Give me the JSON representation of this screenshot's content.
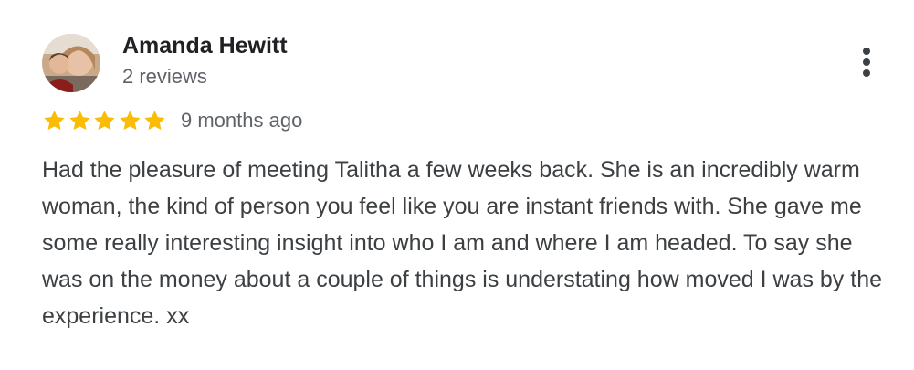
{
  "review": {
    "reviewer_name": "Amanda Hewitt",
    "review_count": "2 reviews",
    "rating": 5,
    "rating_max": 5,
    "star_color": "#fbbc04",
    "timestamp": "9 months ago",
    "text": "Had the pleasure of meeting Talitha a few weeks back. She is an incredibly warm woman, the kind of person you feel like you are instant friends with. She gave me some really interesting insight into who I am and where I am headed. To say she was on the money about a couple of things is understating how moved I was by the experience. xx"
  },
  "icons": {
    "more": "more-vert-icon",
    "star": "star-icon",
    "avatar": "avatar-photo"
  }
}
